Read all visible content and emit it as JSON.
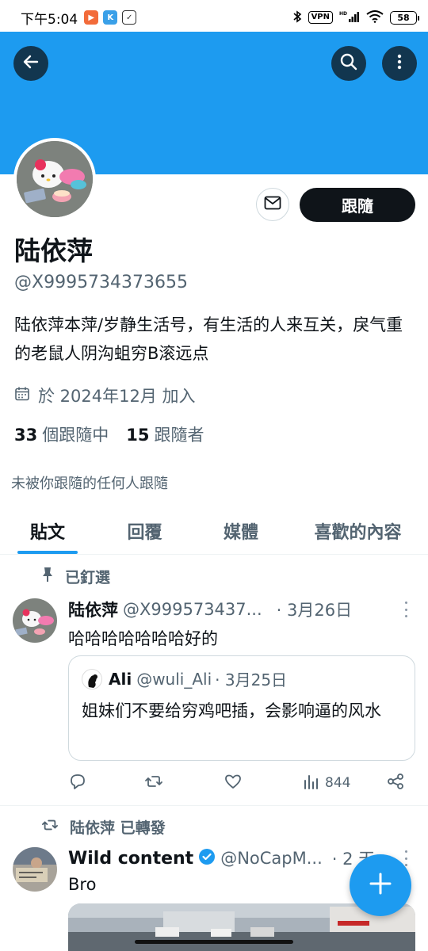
{
  "status_bar": {
    "time": "下午5:04",
    "vpn": "VPN",
    "network": "HD",
    "battery": "58"
  },
  "profile": {
    "display_name": "陆依萍",
    "handle": "@X9995734373655",
    "bio": "陆依萍本萍/岁静生活号，有生活的人来互关，戾气重的老鼠人阴沟蛆穷B滚远点",
    "joined": "於 2024年12月 加入",
    "following_count": "33",
    "following_label": "個跟隨中",
    "followers_count": "15",
    "followers_label": "跟隨者",
    "not_followed_note": "未被你跟隨的任何人跟隨",
    "follow_button": "跟隨"
  },
  "tabs": [
    {
      "label": "貼文",
      "active": true
    },
    {
      "label": "回覆",
      "active": false
    },
    {
      "label": "媒體",
      "active": false
    },
    {
      "label": "喜歡的內容",
      "active": false
    }
  ],
  "posts": [
    {
      "context_label": "已釘選",
      "name": "陆依萍",
      "handle": "@X999573437...",
      "date": "· 3月26日",
      "text": "哈哈哈哈哈哈哈好的",
      "quote": {
        "name": "Ali",
        "handle": "@wuli_Ali",
        "date": "· 3月25日",
        "text": "姐妹们不要给穷鸡吧插，会影响逼的风水"
      },
      "views": "844"
    },
    {
      "context_label": "陆依萍 已轉發",
      "name": "Wild content",
      "handle": "@NoCapM...",
      "date": "· 2 天",
      "text": "Bro",
      "verified": true
    }
  ],
  "colors": {
    "accent": "#1d9bf0",
    "text": "#0f1419",
    "muted": "#536471"
  }
}
